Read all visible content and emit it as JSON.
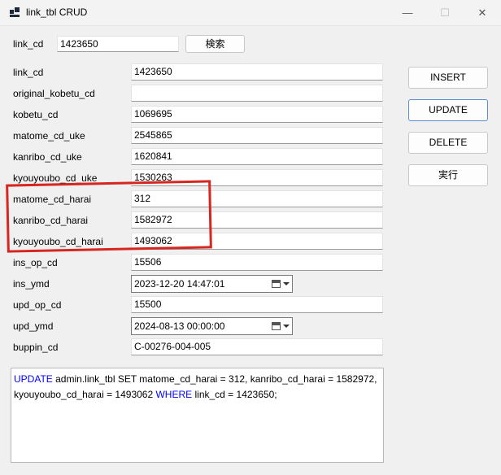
{
  "window": {
    "title": "link_tbl CRUD",
    "minimize_glyph": "—",
    "maximize_glyph": "☐",
    "close_glyph": "✕"
  },
  "search": {
    "label": "link_cd",
    "value": "1423650",
    "button_label": "検索"
  },
  "fields": [
    {
      "label": "link_cd",
      "value": "1423650"
    },
    {
      "label": "original_kobetu_cd",
      "value": ""
    },
    {
      "label": "kobetu_cd",
      "value": "1069695"
    },
    {
      "label": "matome_cd_uke",
      "value": "2545865"
    },
    {
      "label": "kanribo_cd_uke",
      "value": "1620841"
    },
    {
      "label": "kyouyoubo_cd_uke",
      "value": "1530263"
    },
    {
      "label": "matome_cd_harai",
      "value": "312"
    },
    {
      "label": "kanribo_cd_harai",
      "value": "1582972"
    },
    {
      "label": "kyouyoubo_cd_harai",
      "value": "1493062"
    },
    {
      "label": "ins_op_cd",
      "value": "15506"
    },
    {
      "label": "ins_ymd",
      "value": "2023-12-20 14:47:01"
    },
    {
      "label": "upd_op_cd",
      "value": "15500"
    },
    {
      "label": "upd_ymd",
      "value": "2024-08-13 00:00:00"
    },
    {
      "label": "buppin_cd",
      "value": "C-00276-004-005"
    }
  ],
  "buttons": {
    "insert": "INSERT",
    "update": "UPDATE",
    "delete": "DELETE",
    "execute": "実行"
  },
  "sql": {
    "kw_update": "UPDATE",
    "part1": " admin.link_tbl SET matome_cd_harai = 312, kanribo_cd_harai = 1582972, kyouyoubo_cd_harai = 1493062 ",
    "kw_where": "WHERE",
    "part2": " link_cd = 1423650;"
  },
  "colors": {
    "highlight": "#d6261f",
    "sql_keyword": "#0000ff",
    "primary_button_border": "#5a8fd6"
  }
}
